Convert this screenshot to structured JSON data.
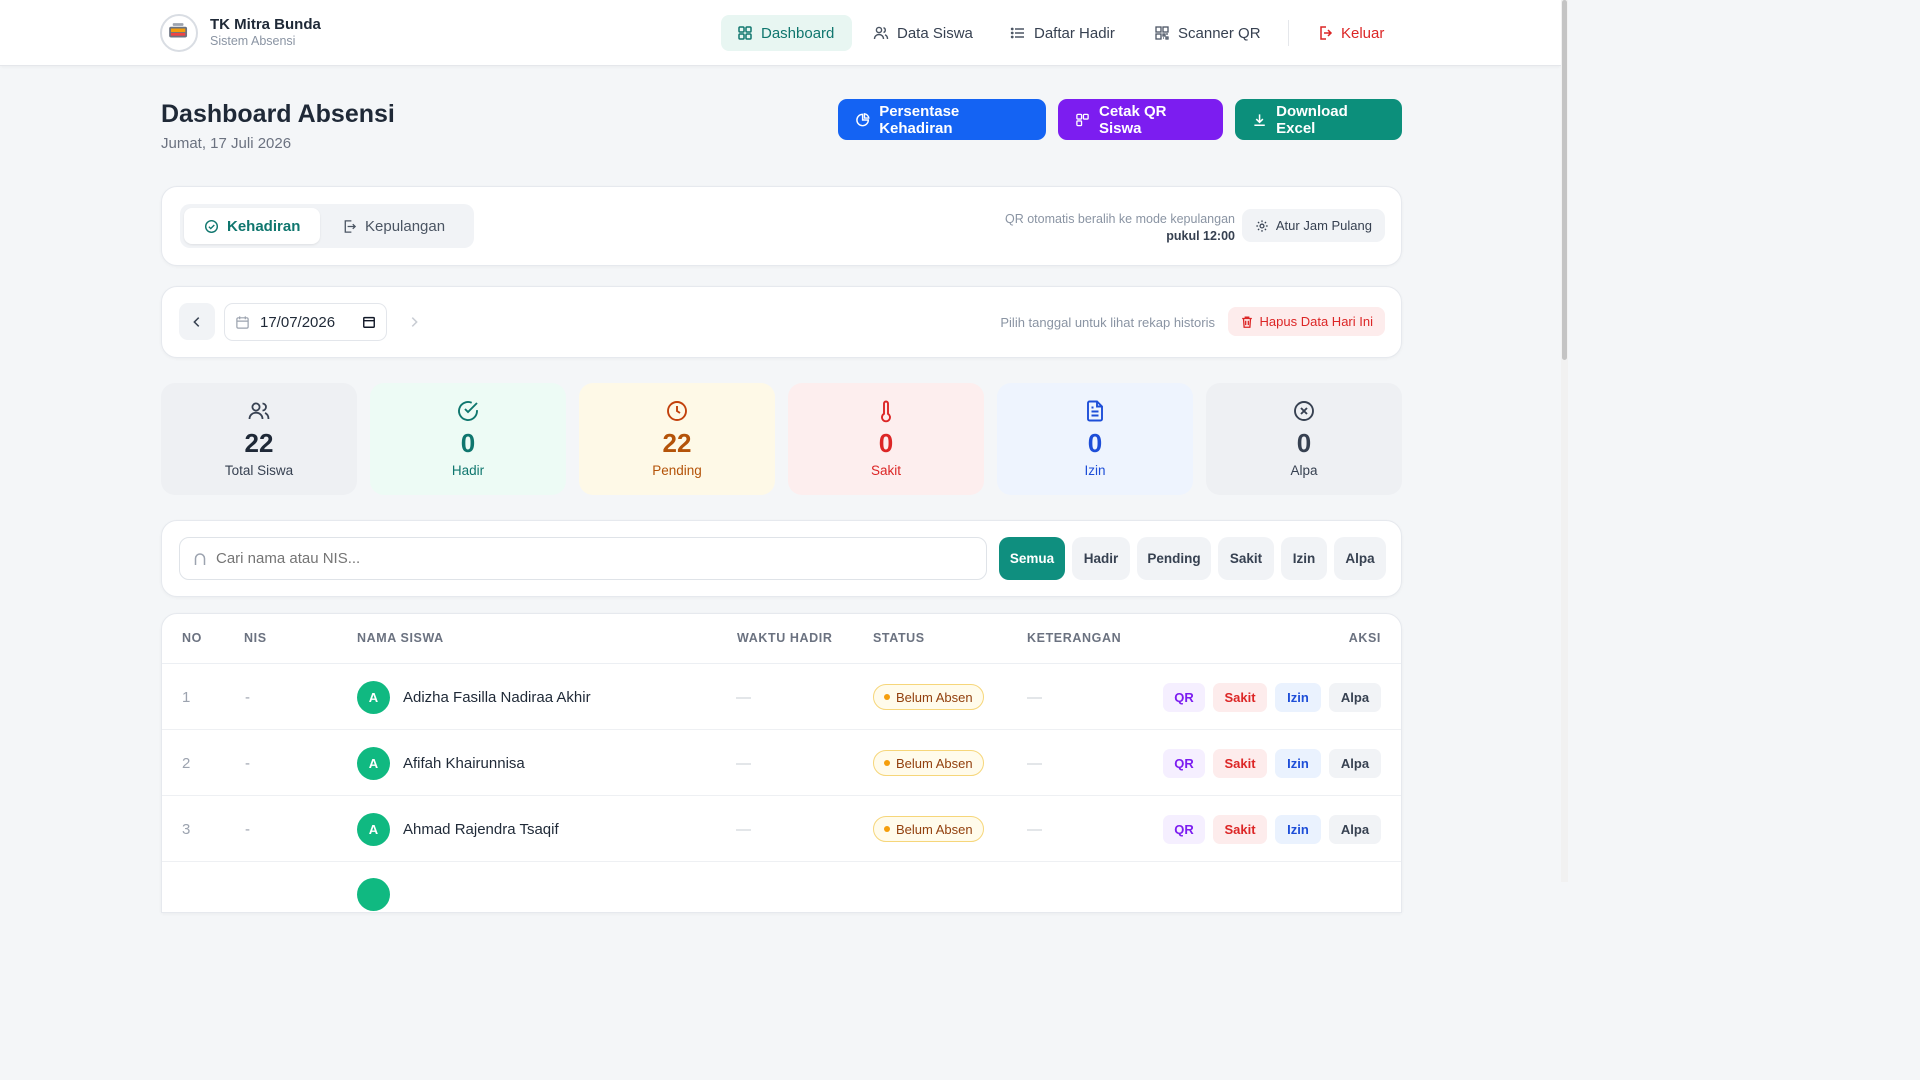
{
  "brand": {
    "title": "TK Mitra Bunda",
    "subtitle": "Sistem Absensi"
  },
  "nav": {
    "dashboard": "Dashboard",
    "data_siswa": "Data Siswa",
    "daftar_hadir": "Daftar Hadir",
    "scanner_qr": "Scanner QR",
    "logout": "Keluar"
  },
  "header": {
    "title": "Dashboard Absensi",
    "date": "Jumat, 17 Juli 2026",
    "btn_persentase": "Persentase Kehadiran",
    "btn_cetak_qr": "Cetak QR Siswa",
    "btn_excel": "Download Excel"
  },
  "mode": {
    "tab_kehadiran": "Kehadiran",
    "tab_kepulangan": "Kepulangan",
    "note_line1": "QR otomatis beralih ke mode kepulangan",
    "note_line2": "pukul 12:00",
    "settings_button": "Atur Jam Pulang"
  },
  "date_filter": {
    "value": "17/07/2026",
    "hint": "Pilih tanggal untuk lihat rekap historis",
    "delete_button": "Hapus Data Hari Ini"
  },
  "stats": {
    "total": {
      "value": "22",
      "label": "Total Siswa"
    },
    "hadir": {
      "value": "0",
      "label": "Hadir"
    },
    "pending": {
      "value": "22",
      "label": "Pending"
    },
    "sakit": {
      "value": "0",
      "label": "Sakit"
    },
    "izin": {
      "value": "0",
      "label": "Izin"
    },
    "alpa": {
      "value": "0",
      "label": "Alpa"
    }
  },
  "filters": {
    "search_placeholder": "Cari nama atau NIS...",
    "chips": [
      "Semua",
      "Hadir",
      "Pending",
      "Sakit",
      "Izin",
      "Alpa"
    ]
  },
  "table": {
    "headers": [
      "NO",
      "NIS",
      "NAMA SISWA",
      "WAKTU HADIR",
      "STATUS",
      "KETERANGAN",
      "AKSI"
    ],
    "rows": [
      {
        "no": "1",
        "nis": "-",
        "initial": "A",
        "name": "Adizha Fasilla Nadiraa Akhir",
        "time": "—",
        "status": "Belum Absen",
        "note": "—"
      },
      {
        "no": "2",
        "nis": "-",
        "initial": "A",
        "name": "Afifah Khairunnisa",
        "time": "—",
        "status": "Belum Absen",
        "note": "—"
      },
      {
        "no": "3",
        "nis": "-",
        "initial": "A",
        "name": "Ahmad Rajendra Tsaqif",
        "time": "—",
        "status": "Belum Absen",
        "note": "—"
      }
    ],
    "actions": {
      "qr": "QR",
      "sakit": "Sakit",
      "izin": "Izin",
      "alpa": "Alpa"
    }
  },
  "colors": {
    "primary_teal": "#0f8f7f",
    "blue": "#1463f3",
    "purple": "#7c1df0",
    "green": "#0c8f7b",
    "danger": "#dc2626"
  }
}
